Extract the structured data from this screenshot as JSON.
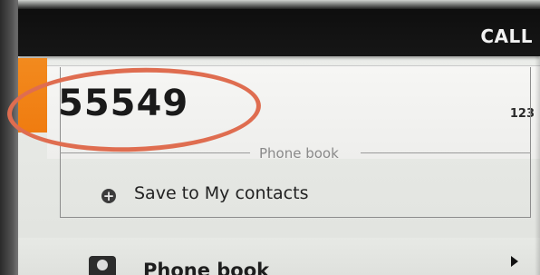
{
  "header": {
    "title": "CALL"
  },
  "input": {
    "value": "55549",
    "mode_label": "123"
  },
  "section": {
    "divider_label": "Phone book"
  },
  "actions": {
    "save_label": "Save to My contacts",
    "save_icon": "plus-circle-icon"
  },
  "list": {
    "items": [
      {
        "label": "Phone book",
        "icon": "contact-icon"
      }
    ]
  },
  "colors": {
    "accent": "#F07C10",
    "annotation": "#DF6D50",
    "top_bar": "#111111"
  }
}
